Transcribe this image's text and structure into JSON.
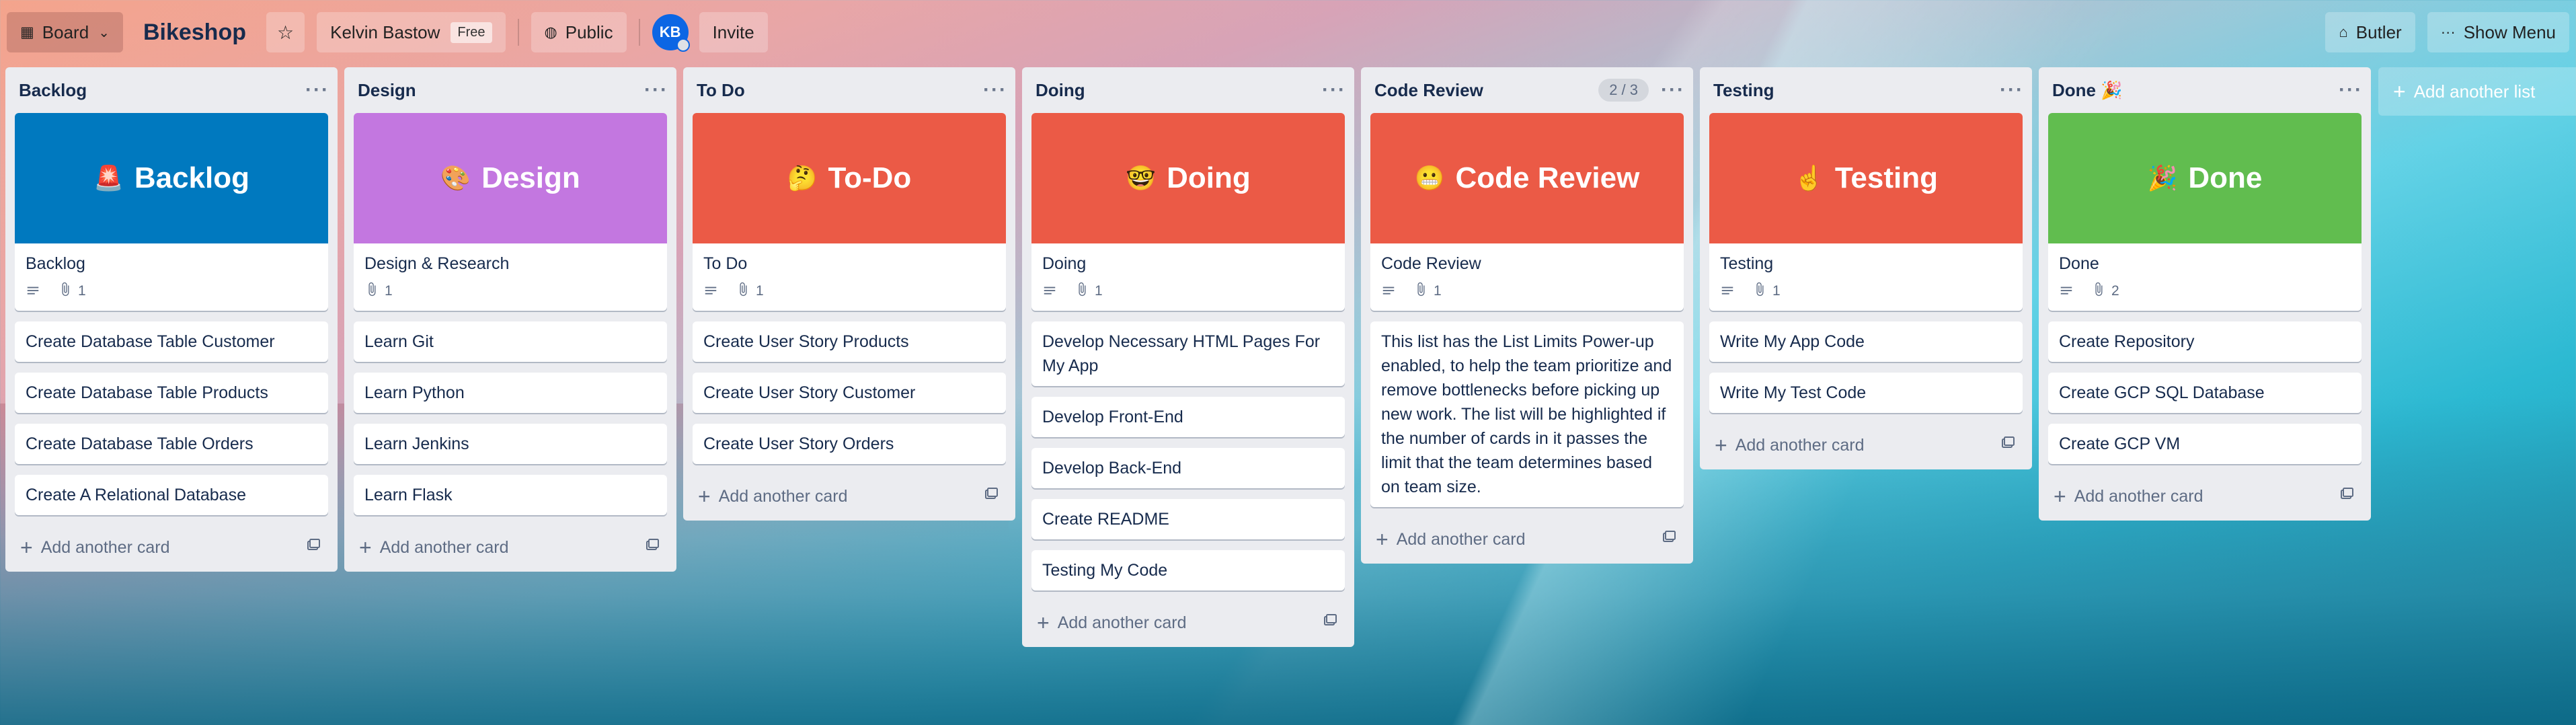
{
  "header": {
    "board_switch_label": "Board",
    "board_title": "Bikeshop",
    "workspace": "Kelvin Bastow",
    "workspace_badge": "Free",
    "visibility": "Public",
    "avatar_initials": "KB",
    "invite": "Invite",
    "butler": "Butler",
    "show_menu": "Show Menu"
  },
  "add_card_label": "Add another card",
  "add_list_label": "Add another list",
  "lists": [
    {
      "title": "Backlog",
      "cover": {
        "emoji": "🚨",
        "text": "Backlog",
        "color": "#0079bf"
      },
      "cover_card": {
        "title": "Backlog",
        "attachments": "1"
      },
      "cards": [
        "Create Database Table Customer",
        "Create Database Table Products",
        "Create Database Table Orders",
        "Create A Relational Database"
      ]
    },
    {
      "title": "Design",
      "cover": {
        "emoji": "🎨",
        "text": "Design",
        "color": "#c377e0"
      },
      "cover_card": {
        "title": "Design & Research",
        "attachments": "1"
      },
      "cards": [
        "Learn Git",
        "Learn Python",
        "Learn Jenkins",
        "Learn Flask"
      ]
    },
    {
      "title": "To Do",
      "cover": {
        "emoji": "🤔",
        "text": "To-Do",
        "color": "#eb5a46"
      },
      "cover_card": {
        "title": "To Do",
        "attachments": "1"
      },
      "cards": [
        "Create User Story Products",
        "Create User Story Customer",
        "Create User Story Orders"
      ]
    },
    {
      "title": "Doing",
      "cover": {
        "emoji": "🤓",
        "text": "Doing",
        "color": "#eb5a46"
      },
      "cover_card": {
        "title": "Doing",
        "attachments": "1"
      },
      "cards": [
        "Develop Necessary HTML Pages For My App",
        "Develop Front-End",
        "Develop Back-End",
        "Create README",
        "Testing My Code"
      ]
    },
    {
      "title": "Code Review",
      "limit": "2 / 3",
      "cover": {
        "emoji": "😬",
        "text": "Code Review",
        "color": "#eb5a46"
      },
      "cover_card": {
        "title": "Code Review",
        "attachments": "1"
      },
      "cards": [
        "This list has the List Limits Power-up enabled, to help the team prioritize and remove bottlenecks before picking up new work. The list will be highlighted if the number of cards in it passes the limit that the team determines based on team size."
      ]
    },
    {
      "title": "Testing",
      "cover": {
        "emoji": "☝️",
        "text": "Testing",
        "color": "#eb5a46"
      },
      "cover_card": {
        "title": "Testing",
        "attachments": "1"
      },
      "cards": [
        "Write My App Code",
        "Write My Test Code"
      ]
    },
    {
      "title": "Done 🎉",
      "cover": {
        "emoji": "🎉",
        "text": "Done",
        "color": "#61bd4f"
      },
      "cover_card": {
        "title": "Done",
        "attachments": "2"
      },
      "cards": [
        "Create Repository",
        "Create GCP SQL Database",
        "Create GCP VM"
      ]
    }
  ]
}
